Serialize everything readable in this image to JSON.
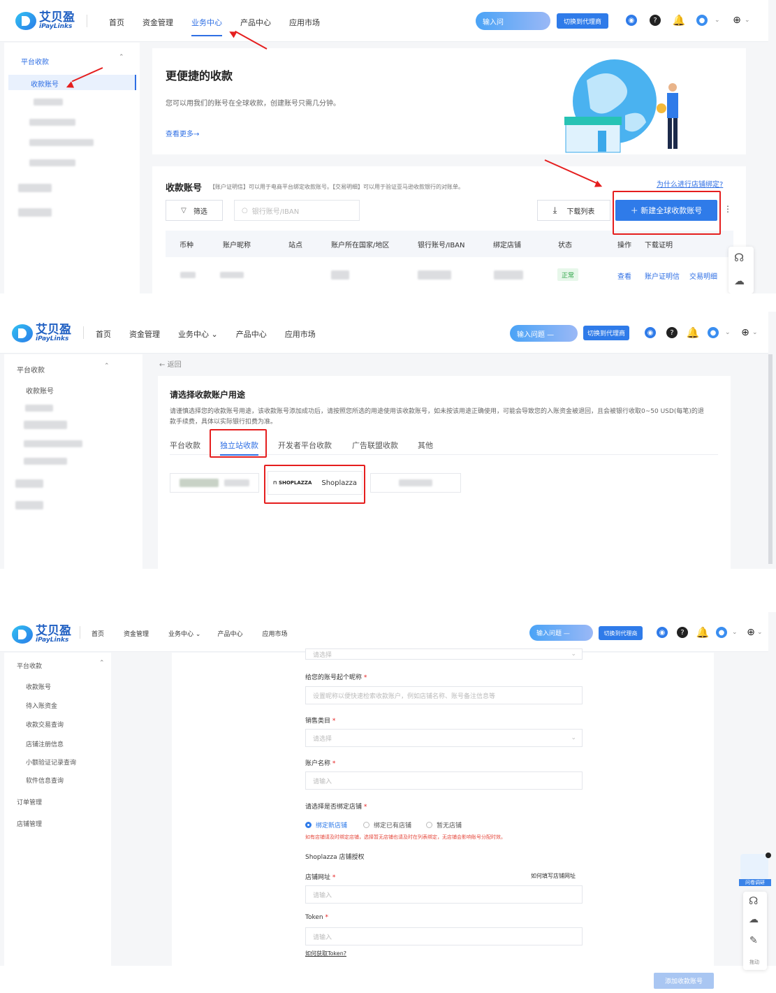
{
  "brand": {
    "cn": "艾贝盈",
    "en": "iPayLinks"
  },
  "nav": {
    "home": "首页",
    "funds": "资金管理",
    "business": "业务中心",
    "products": "产品中心",
    "market": "应用市场"
  },
  "header": {
    "search_p1": "输入问",
    "search_p2": "输入问题 —",
    "agent_btn": "切换到代理商"
  },
  "panel1": {
    "sidebar": {
      "section": "平台收款",
      "active_item": "收款账号"
    },
    "hero": {
      "title": "更便捷的收款",
      "desc": "您可以用我们的账号在全球收款，创建账号只需几分钟。",
      "more": "查看更多→"
    },
    "accounts": {
      "title": "收款账号",
      "desc": "【账户证明信】可以用于电商平台绑定收款账号。【交易明细】可以用于验证亚马逊收款银行的对账单。",
      "why_link": "为什么进行店铺绑定?",
      "filter_btn": "筛选",
      "search_placeholder": "银行账号/IBAN",
      "download_btn": "下载列表",
      "new_btn": "＋ 新建全球收款账号",
      "columns": [
        "币种",
        "账户昵称",
        "站点",
        "账户所在国家/地区",
        "银行账号/IBAN",
        "绑定店铺",
        "状态",
        "操作",
        "下载证明"
      ],
      "row_status": "正常",
      "row_view": "查看",
      "row_cert": "账户证明信",
      "row_tx": "交易明细"
    }
  },
  "panel2": {
    "sidebar": {
      "section": "平台收款",
      "item": "收款账号"
    },
    "back": "返回",
    "title": "请选择收款账户用途",
    "desc": "请谨慎选择您的收款账号用途，该收款账号添加成功后，请按照您所选的用途使用该收款账号，如未按该用途正确使用，可能会导致您的入账资金被退回，且会被银行收取0~50 USD(每笔)的退款手续费，具体以实际银行扣费为准。",
    "tabs": [
      "平台收款",
      "独立站收款",
      "开发者平台收款",
      "广告联盟收款",
      "其他"
    ],
    "shoplazza_logo": "SHOPLAZZA",
    "shoplazza_name": "Shoplazza"
  },
  "panel3": {
    "sidebar": {
      "section": "平台收款",
      "items": [
        "收款账号",
        "待入账资金",
        "收款交易查询",
        "店铺注册信息",
        "小额验证记录查询",
        "软件信息查询"
      ],
      "order": "订单管理",
      "store": "店铺管理"
    },
    "form": {
      "top_placeholder": "请选择",
      "nickname_label": "给您的账号起个昵称",
      "nickname_placeholder": "设置昵称以便快速检索收款账户，例如店铺名称、账号备注信息等",
      "category_label": "销售类目",
      "category_placeholder": "请选择",
      "account_label": "账户名称",
      "account_placeholder": "请输入",
      "bind_label": "请选择是否绑定店铺",
      "radio_new": "绑定新店铺",
      "radio_existing": "绑定已有店铺",
      "radio_none": "暂无店铺",
      "bind_tip": "如有店铺请及时绑定店铺，选择暂无店铺也请及时在列表绑定，无店铺会影响账号分配时效。",
      "auth_title": "Shoplazza 店铺授权",
      "url_label": "店铺网址",
      "url_help": "如何填写店铺网址",
      "url_placeholder": "请输入",
      "token_label": "Token",
      "token_placeholder": "请输入",
      "token_help": "如何获取Token?",
      "submit": "添加收款账号"
    },
    "survey": "问卷调研",
    "move": "拖动"
  },
  "colors": {
    "primary": "#2f7be9",
    "annotation": "#e51e1e"
  }
}
